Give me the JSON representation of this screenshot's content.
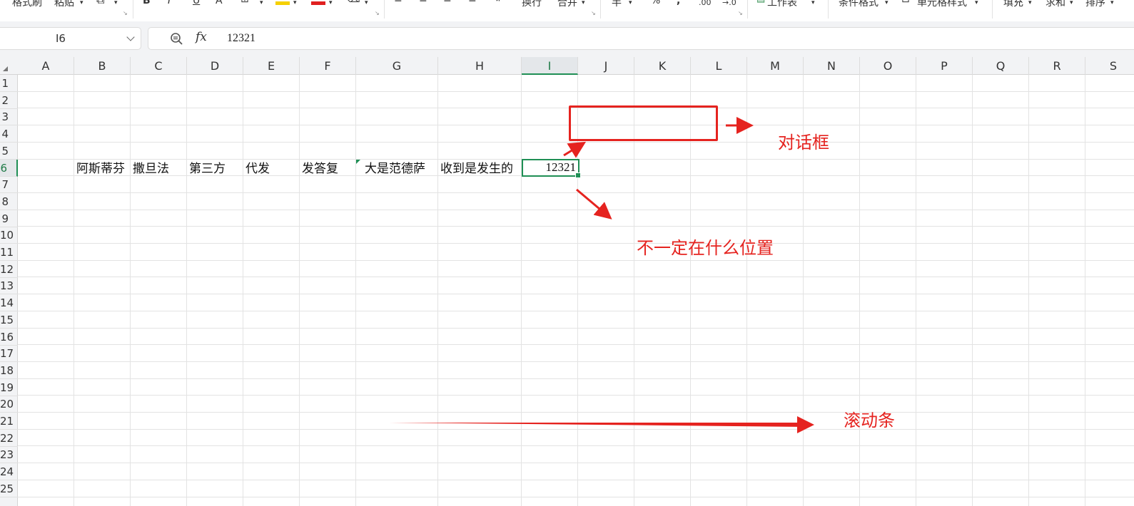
{
  "toolbar": {
    "items": [
      "格式刷",
      "粘贴",
      "B",
      "I",
      "U",
      "A",
      "换行",
      "合并",
      "半",
      "%",
      ",",
      ".00",
      "→.0",
      "工作表",
      "条件格式",
      "单元格样式",
      "填充",
      "求和",
      "排序"
    ]
  },
  "formula_bar": {
    "name_box": "I6",
    "fx_label": "fx",
    "value": "12321"
  },
  "columns": [
    "A",
    "B",
    "C",
    "D",
    "E",
    "F",
    "G",
    "H",
    "I",
    "J",
    "K",
    "L",
    "M",
    "N",
    "O",
    "P",
    "Q",
    "R",
    "S"
  ],
  "selected_column": "I",
  "rows": [
    "1",
    "2",
    "3",
    "4",
    "5",
    "6",
    "7",
    "8",
    "9",
    "10",
    "11",
    "12",
    "13",
    "14",
    "15",
    "16",
    "17",
    "18",
    "19",
    "20",
    "21",
    "22",
    "23",
    "24",
    "25"
  ],
  "selected_row": "6",
  "row6": {
    "B": "阿斯蒂芬",
    "C": "撒旦法",
    "D": "第三方",
    "E": "代发",
    "F": "发答复",
    "G": "大是范德萨",
    "H": "收到是发生的",
    "I": "12321"
  },
  "annotations": {
    "dialog_label": "对话框",
    "position_label": "不一定在什么位置",
    "scrollbar_label": "滚动条"
  },
  "colors": {
    "annotation_red": "#e5231f",
    "selection_green": "#1f8f55"
  }
}
